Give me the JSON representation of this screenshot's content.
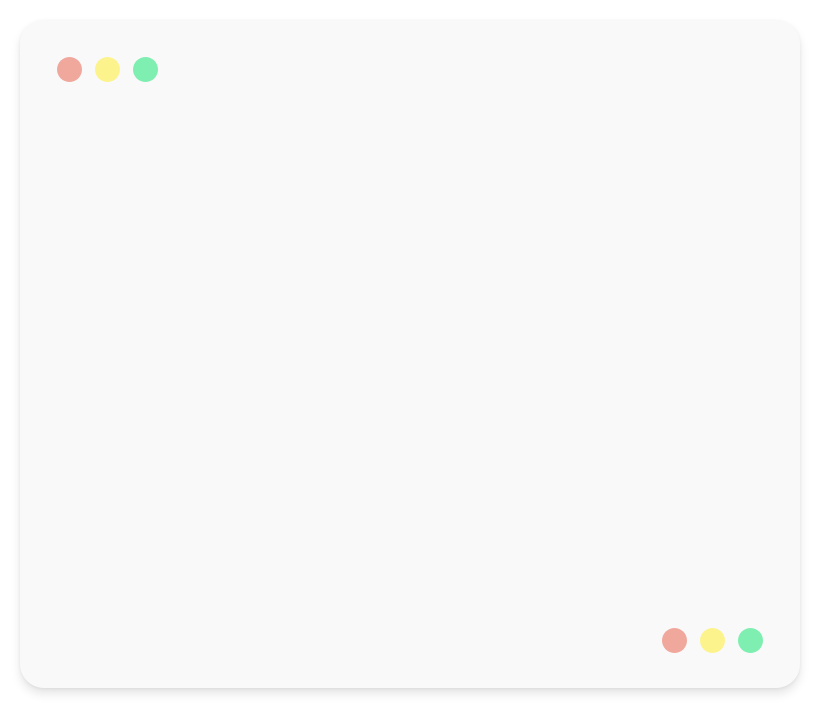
{
  "window": {
    "background": "#f9f9fa",
    "top_controls": [
      {
        "name": "close",
        "color": "#f0a89c"
      },
      {
        "name": "minimize",
        "color": "#fdf38d"
      },
      {
        "name": "maximize",
        "color": "#7eefb0"
      }
    ],
    "bottom_controls": [
      {
        "name": "close",
        "color": "#f0a89c"
      },
      {
        "name": "minimize",
        "color": "#fdf38d"
      },
      {
        "name": "maximize",
        "color": "#7eefb0"
      }
    ]
  }
}
